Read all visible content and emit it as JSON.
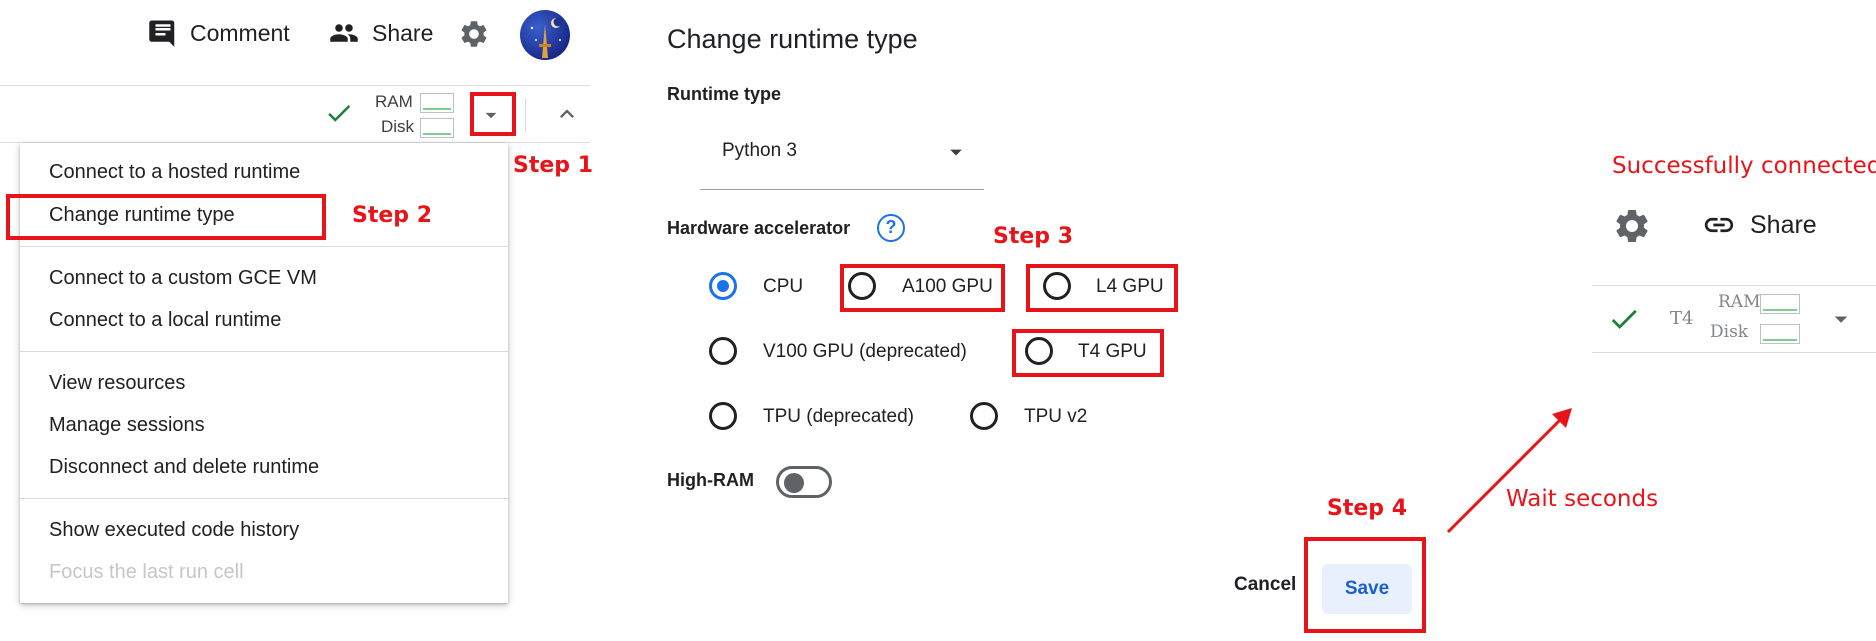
{
  "header": {
    "comment_label": "Comment",
    "share_label": "Share"
  },
  "toolbar": {
    "ram_label": "RAM",
    "disk_label": "Disk"
  },
  "menu": {
    "items": [
      {
        "label": "Connect to a hosted runtime"
      },
      {
        "label": "Change runtime type"
      },
      {
        "label": "Connect to a custom GCE VM"
      },
      {
        "label": "Connect to a local runtime"
      },
      {
        "label": "View resources"
      },
      {
        "label": "Manage sessions"
      },
      {
        "label": "Disconnect and delete runtime"
      },
      {
        "label": "Show executed code history"
      },
      {
        "label": "Focus the last run cell",
        "disabled": true
      }
    ]
  },
  "dialog": {
    "title": "Change runtime type",
    "runtime_type_label": "Runtime type",
    "runtime_type_value": "Python 3",
    "hardware_label": "Hardware accelerator",
    "help_glyph": "?",
    "options": [
      {
        "label": "CPU",
        "checked": true
      },
      {
        "label": "A100 GPU",
        "checked": false
      },
      {
        "label": "L4 GPU",
        "checked": false
      },
      {
        "label": "V100 GPU (deprecated)",
        "checked": false
      },
      {
        "label": "T4 GPU",
        "checked": false
      },
      {
        "label": "TPU (deprecated)",
        "checked": false
      },
      {
        "label": "TPU v2",
        "checked": false
      }
    ],
    "high_ram_label": "High-RAM",
    "high_ram_on": false,
    "cancel_label": "Cancel",
    "save_label": "Save"
  },
  "annotations": {
    "step1": "Step 1",
    "step2": "Step 2",
    "step3": "Step 3",
    "step4": "Step 4",
    "success": "Successfully connected",
    "wait": "Wait seconds"
  },
  "right_panel": {
    "share_label": "Share",
    "runtime_name": "T4",
    "ram_label": "RAM",
    "disk_label": "Disk"
  },
  "colors": {
    "accent": "#1a73e8",
    "annotation_red": "#e8141a",
    "connected_green": "#188038"
  }
}
